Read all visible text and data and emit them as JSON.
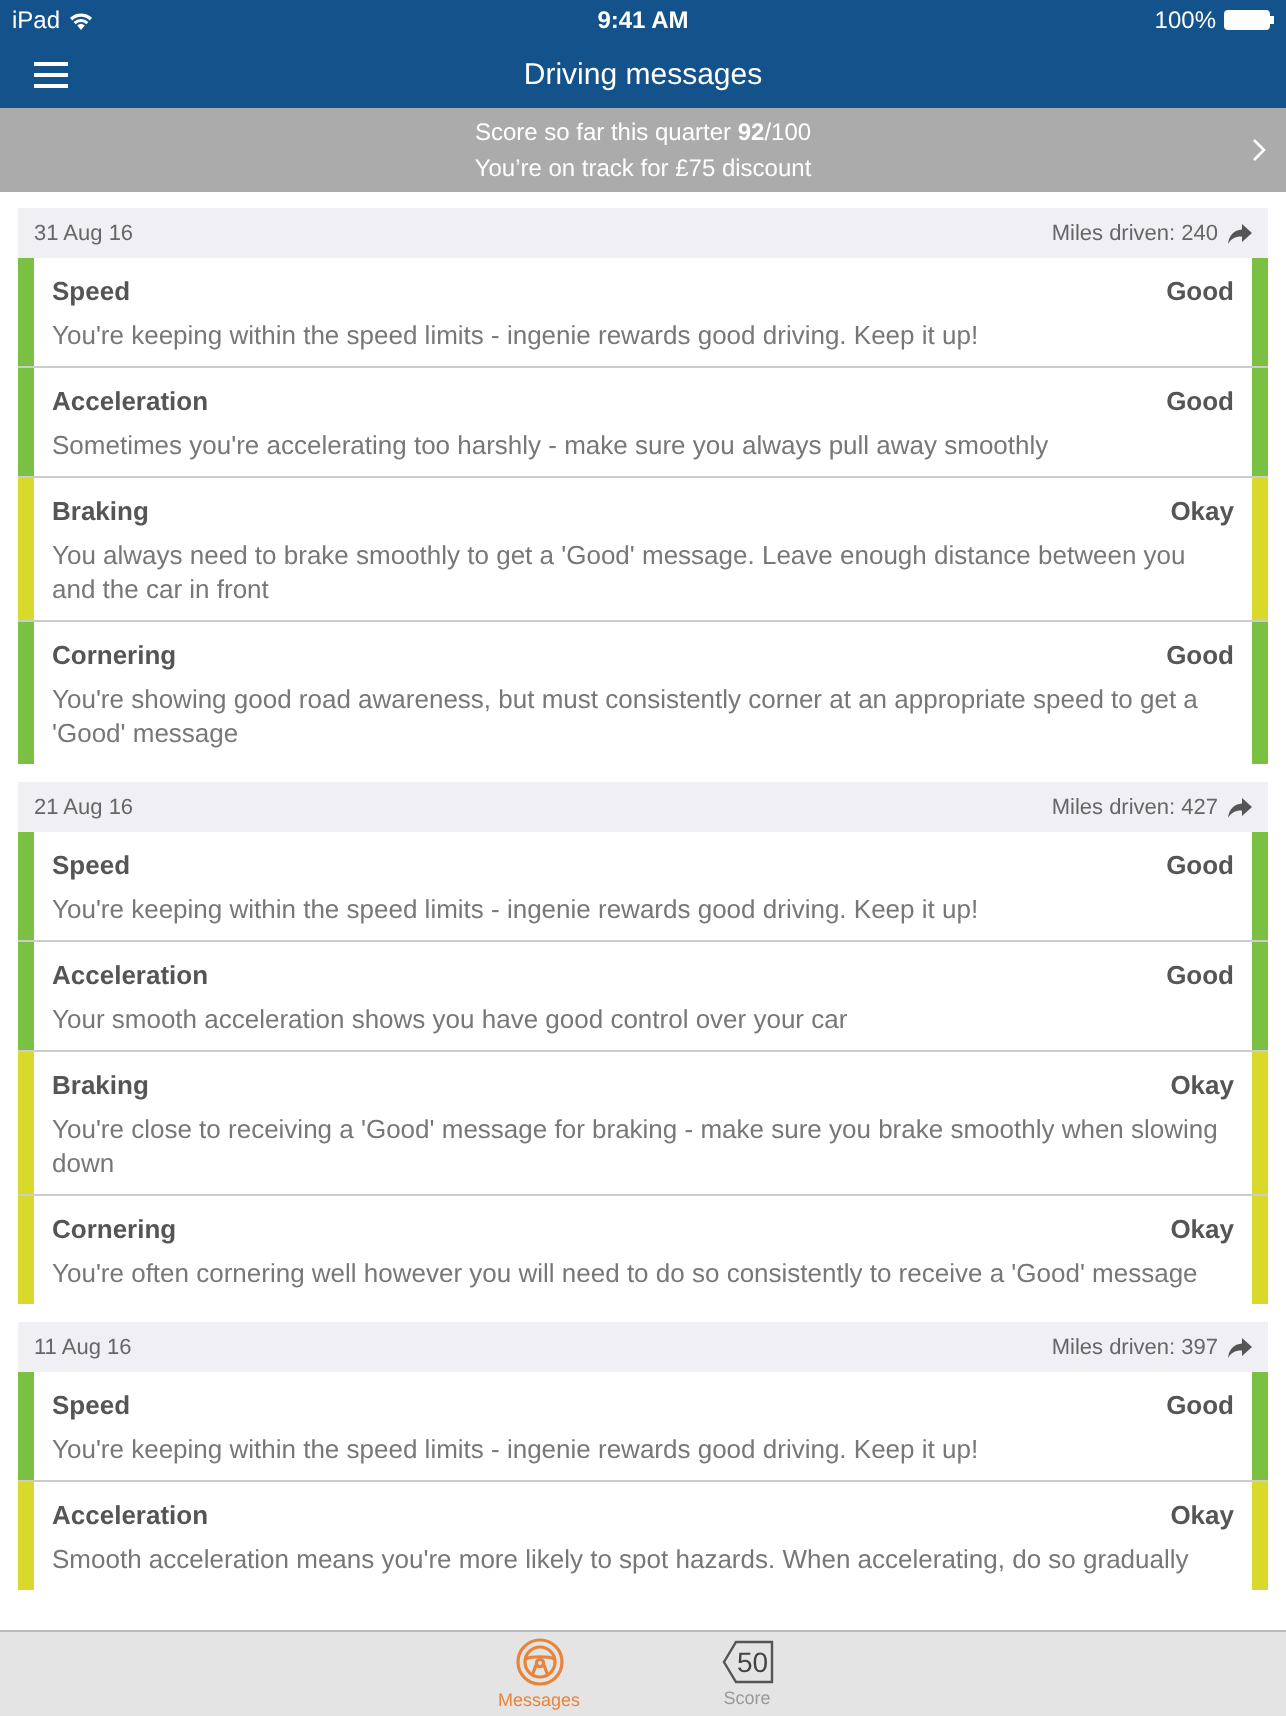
{
  "status_bar": {
    "device": "iPad",
    "time": "9:41 AM",
    "battery": "100%"
  },
  "nav_bar": {
    "title": "Driving messages"
  },
  "banner": {
    "line_1": "Score so far this quarter **92**/100",
    "line_2": "You’re on track for £75 discount"
  },
  "days": [
    {
      "date": "31 Aug 16",
      "miles": "Miles driven: 240",
      "messages": [
        {
          "category": "Speed",
          "rating": "Good",
          "color": "#7ac143",
          "text": "You're keeping within the speed limits - ingenie rewards good driving. Keep it up!"
        },
        {
          "category": "Acceleration",
          "rating": "Good",
          "color": "#7ac143",
          "text": "Sometimes you're accelerating too harshly - make sure you always pull away smoothly"
        },
        {
          "category": "Braking",
          "rating": "Okay",
          "color": "#d9d92b",
          "text": "You always need to brake smoothly to get a 'Good' message. Leave enough distance between you and the car in front"
        },
        {
          "category": "Cornering",
          "rating": "Good",
          "color": "#7ac143",
          "text": "You're showing good road awareness, but must consistently corner at an appropriate speed to get a 'Good' message"
        }
      ]
    },
    {
      "date": "21 Aug 16",
      "miles": "Miles driven: 427",
      "messages": [
        {
          "category": "Speed",
          "rating": "Good",
          "color": "#7ac143",
          "text": "You're keeping within the speed limits - ingenie rewards good driving. Keep it up!"
        },
        {
          "category": "Acceleration",
          "rating": "Good",
          "color": "#7ac143",
          "text": "Your smooth acceleration shows you have good control over your car"
        },
        {
          "category": "Braking",
          "rating": "Okay",
          "color": "#d9d92b",
          "text": "You're close to receiving a 'Good' message for braking - make sure you brake smoothly when slowing down"
        },
        {
          "category": "Cornering",
          "rating": "Okay",
          "color": "#d9d92b",
          "text": "You're often cornering well however you will need to do so consistently to receive a 'Good' message"
        }
      ]
    },
    {
      "date": "11 Aug 16",
      "miles": "Miles driven: 397",
      "messages": [
        {
          "category": "Speed",
          "rating": "Good",
          "color": "#7ac143",
          "text": "You're keeping within the speed limits - ingenie rewards good driving. Keep it up!"
        },
        {
          "category": "Acceleration",
          "rating": "Okay",
          "color": "#d9d92b",
          "text": "Smooth acceleration means you're more likely to spot hazards. When accelerating, do so gradually"
        }
      ]
    }
  ],
  "tab_bar": [
    {
      "kind": "wheel",
      "label": "Messages",
      "selected": true
    },
    {
      "kind": "sign",
      "label": "Score",
      "badge": "50",
      "selected": false
    }
  ]
}
